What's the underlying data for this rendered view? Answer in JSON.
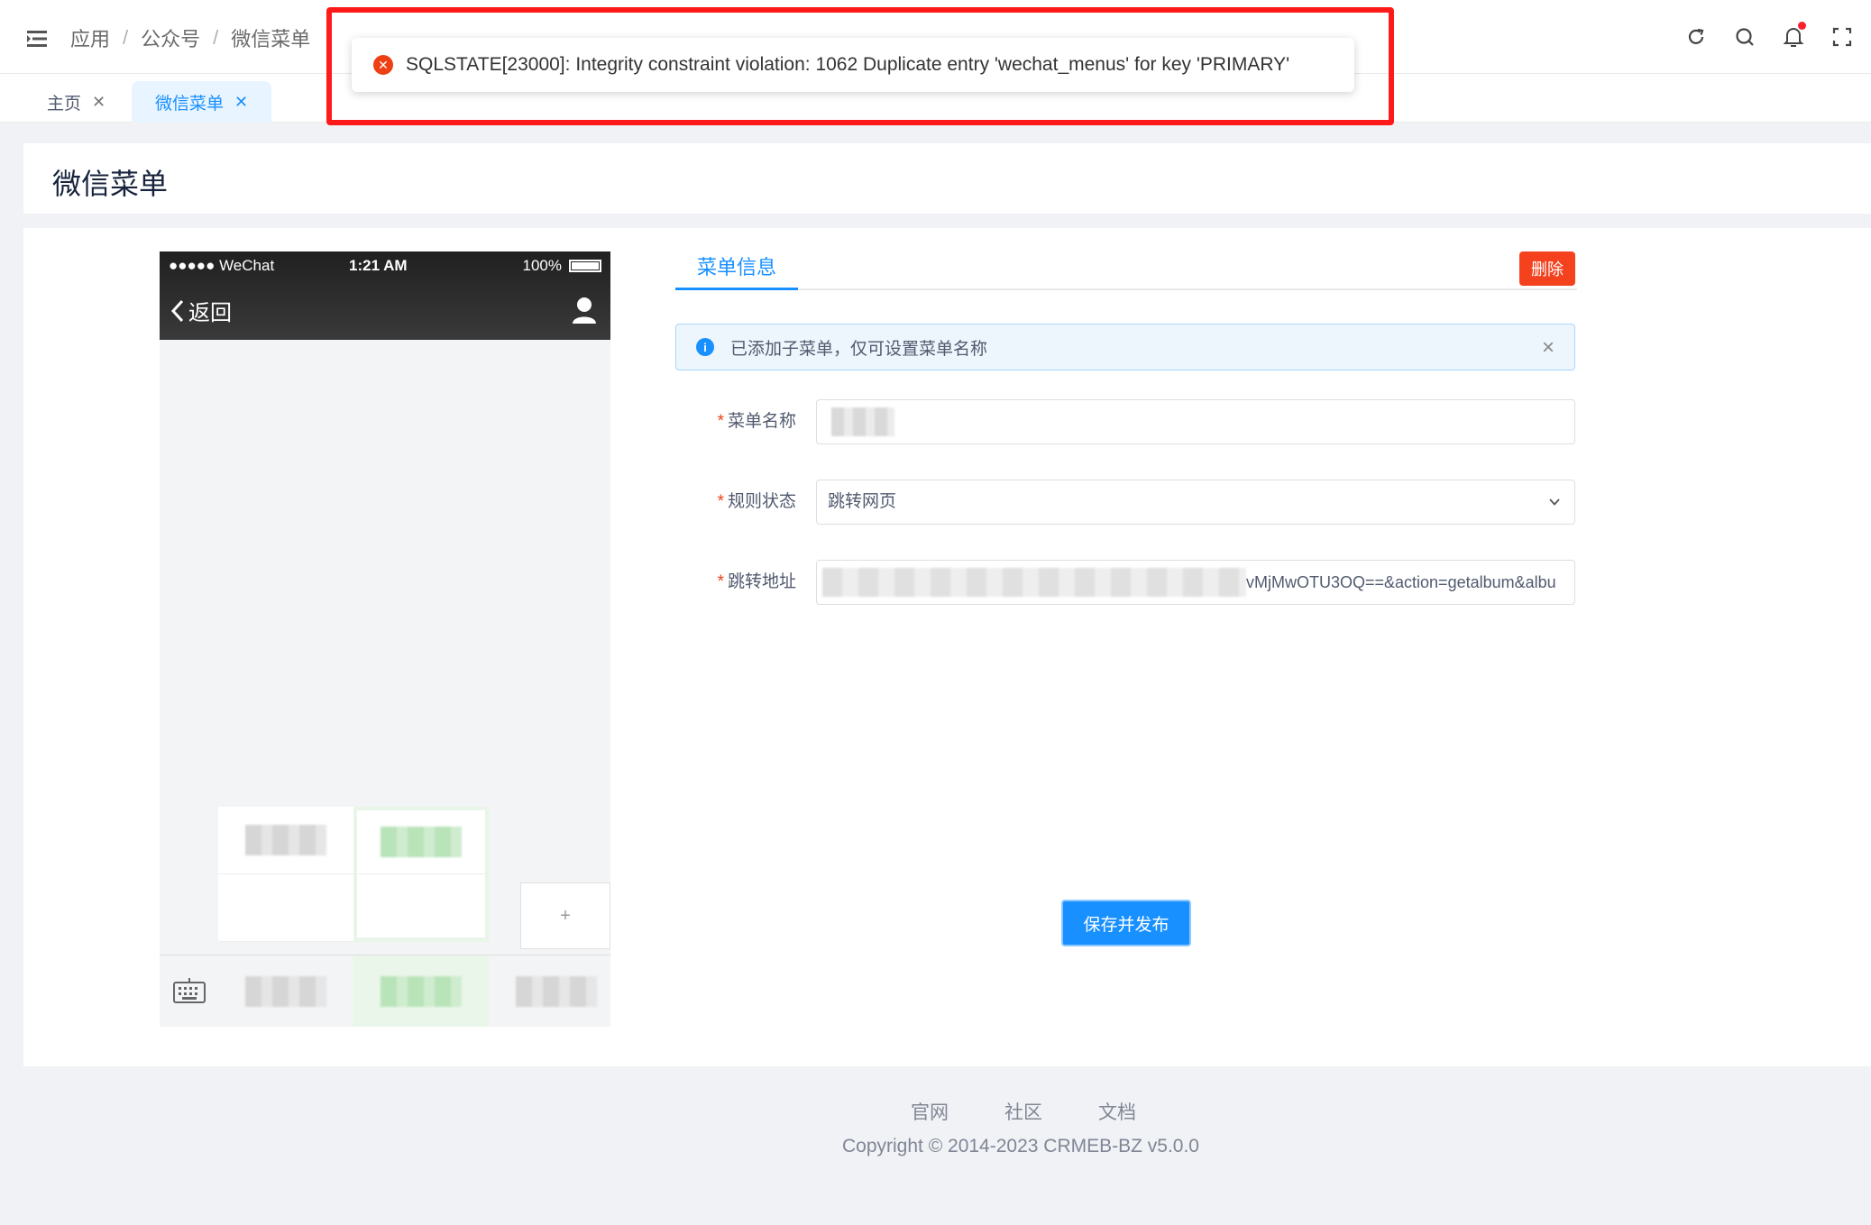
{
  "header": {
    "breadcrumb": [
      "应用",
      "公众号",
      "微信菜单"
    ],
    "separator": "/",
    "icons": [
      "refresh-icon",
      "search-icon",
      "bell-icon",
      "fullscreen-icon"
    ]
  },
  "tabs": [
    {
      "label": "主页",
      "active": false
    },
    {
      "label": "微信菜单",
      "active": true
    }
  ],
  "page_title": "微信菜单",
  "phone": {
    "carrier": "●●●●● WeChat",
    "time": "1:21 AM",
    "battery": "100%",
    "back_label": "返回",
    "plus_label": "+"
  },
  "panel": {
    "tab_label": "菜单信息",
    "delete_label": "删除",
    "alert_text": "已添加子菜单，仅可设置菜单名称",
    "fields": {
      "name_label": "菜单名称",
      "rule_label": "规则状态",
      "rule_value": "跳转网页",
      "url_label": "跳转地址",
      "url_value_visible": "vMjMwOTU3OQ==&action=getalbum&albu"
    },
    "save_label": "保存并发布"
  },
  "footer": {
    "links": [
      "官网",
      "社区",
      "文档"
    ],
    "copyright": "Copyright © 2014-2023 CRMEB-BZ v5.0.0"
  },
  "toast": {
    "message": "SQLSTATE[23000]: Integrity constraint violation: 1062 Duplicate entry 'wechat_menus' for key 'PRIMARY'",
    "accent": "#ff1a1a"
  },
  "colors": {
    "primary": "#1890ff",
    "danger": "#f4411e"
  }
}
